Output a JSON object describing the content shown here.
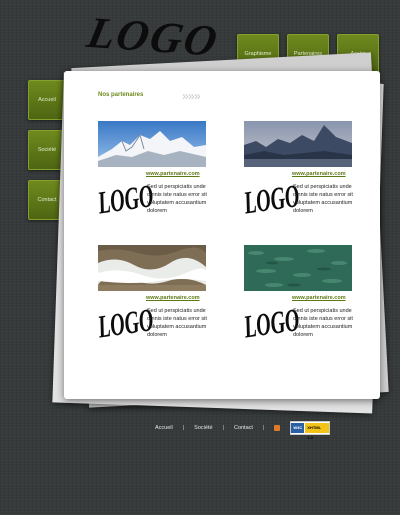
{
  "logo": "LOGO",
  "topnav": [
    "Graphisme",
    "Partenaires",
    "Accès"
  ],
  "sidenav": [
    "Accueil",
    "Société",
    "Contact"
  ],
  "main": {
    "heading": "Nos partenaires",
    "arrows": "» » »",
    "cards": [
      {
        "photo": "mountain-snow",
        "link": "www.partenaire.com",
        "logo": "LOGO",
        "desc": "Sed ut perspiciatis unde omnis iste natus error sit voluptatem accusantium dolorem"
      },
      {
        "photo": "mountain-lake",
        "link": "www.partenaire.com",
        "logo": "LOGO",
        "desc": "Sed ut perspiciatis unde omnis iste natus error sit voluptatem accusantium dolorem"
      },
      {
        "photo": "beach-waves",
        "link": "www.partenaire.com",
        "logo": "LOGO",
        "desc": "Sed ut perspiciatis unde omnis iste natus error sit voluptatem accusantium dolorem"
      },
      {
        "photo": "water-surface",
        "link": "www.partenaire.com",
        "logo": "LOGO",
        "desc": "Sed ut perspiciatis unde omnis iste natus error sit voluptatem accusantium dolorem"
      }
    ]
  },
  "footer": {
    "links": [
      "Accueil",
      "Société",
      "Contact"
    ],
    "separator": "|",
    "badge": {
      "w3c": "W3C",
      "xhtml": "XHTML 1.0"
    }
  },
  "colors": {
    "accent": "#6b8a1b",
    "tab": "#5e7a18",
    "background": "#363a3b"
  }
}
